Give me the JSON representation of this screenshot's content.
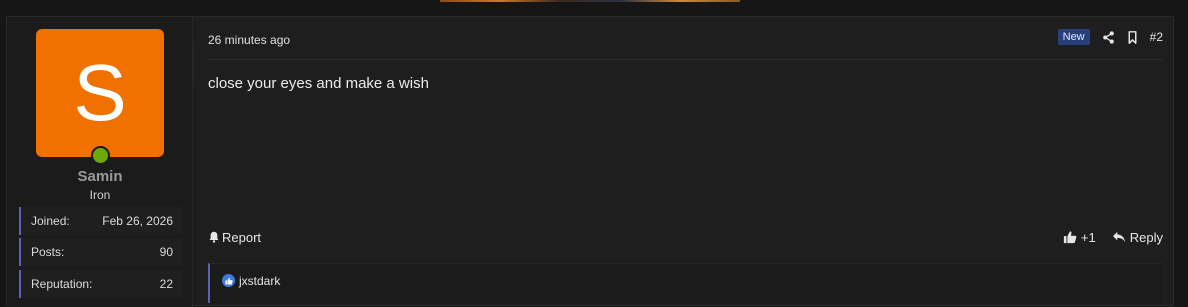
{
  "user": {
    "avatar_letter": "S",
    "name": "Samin",
    "rank": "Iron",
    "stats": [
      {
        "label": "Joined:",
        "value": "Feb 26, 2026"
      },
      {
        "label": "Posts:",
        "value": "90"
      },
      {
        "label": "Reputation:",
        "value": "22"
      }
    ],
    "online_color": "#6fa80c",
    "avatar_color": "#f07000"
  },
  "post": {
    "time": "26 minutes ago",
    "badge": "New",
    "number": "#2",
    "message": "close your eyes and make a wish",
    "share_icon": "share-icon",
    "bookmark_icon": "bookmark-icon"
  },
  "footer": {
    "report_label": "Report",
    "like_count": "+1",
    "reply_label": "Reply"
  },
  "reactions": {
    "users": "jxstdark",
    "icon": "like-icon"
  }
}
